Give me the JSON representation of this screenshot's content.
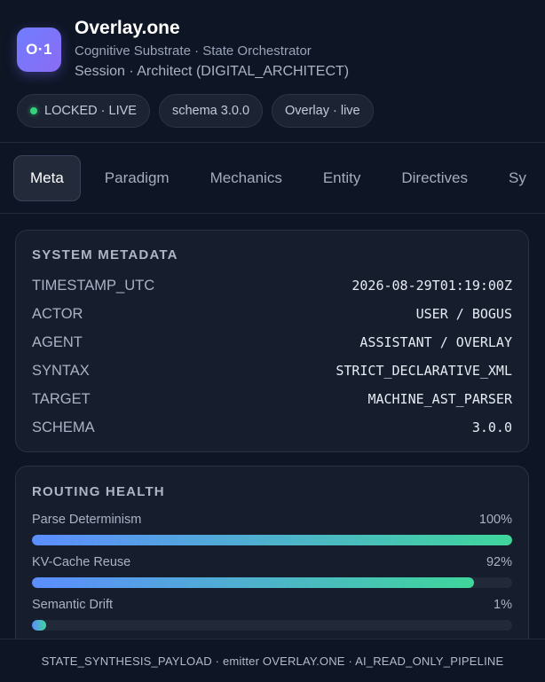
{
  "app": {
    "logo_text": "O·1",
    "title": "Overlay.one",
    "subtitle": "Cognitive Substrate · State Orchestrator",
    "session": "Session · Architect (DIGITAL_ARCHITECT)"
  },
  "badges": [
    {
      "label": "LOCKED · LIVE",
      "status_color": "#34d27a"
    },
    {
      "label": "schema 3.0.0"
    },
    {
      "label": "Overlay · live"
    }
  ],
  "tabs": [
    {
      "label": "Meta",
      "active": true
    },
    {
      "label": "Paradigm"
    },
    {
      "label": "Mechanics"
    },
    {
      "label": "Entity"
    },
    {
      "label": "Directives"
    },
    {
      "label": "Sy"
    }
  ],
  "metadata": {
    "title": "SYSTEM METADATA",
    "rows": [
      {
        "key": "TIMESTAMP_UTC",
        "value": "2026-08-29T01:19:00Z"
      },
      {
        "key": "ACTOR",
        "value": "USER / BOGUS"
      },
      {
        "key": "AGENT",
        "value": "ASSISTANT / OVERLAY"
      },
      {
        "key": "SYNTAX",
        "value": "STRICT_DECLARATIVE_XML"
      },
      {
        "key": "TARGET",
        "value": "MACHINE_AST_PARSER"
      },
      {
        "key": "SCHEMA",
        "value": "3.0.0"
      }
    ]
  },
  "routing": {
    "title": "ROUTING HEALTH",
    "metrics": [
      {
        "label": "Parse Determinism",
        "value_text": "100%",
        "value": 100
      },
      {
        "label": "KV-Cache Reuse",
        "value_text": "92%",
        "value": 92
      },
      {
        "label": "Semantic Drift",
        "value_text": "1%",
        "value": 1
      }
    ]
  },
  "footer": {
    "text": "STATE_SYNTHESIS_PAYLOAD · emitter OVERLAY.ONE · AI_READ_ONLY_PIPELINE"
  },
  "colors": {
    "background": "#0e1524",
    "accent_gradient_start": "#5c8dff",
    "accent_gradient_end": "#3fd69b",
    "live_dot": "#34d27a"
  }
}
